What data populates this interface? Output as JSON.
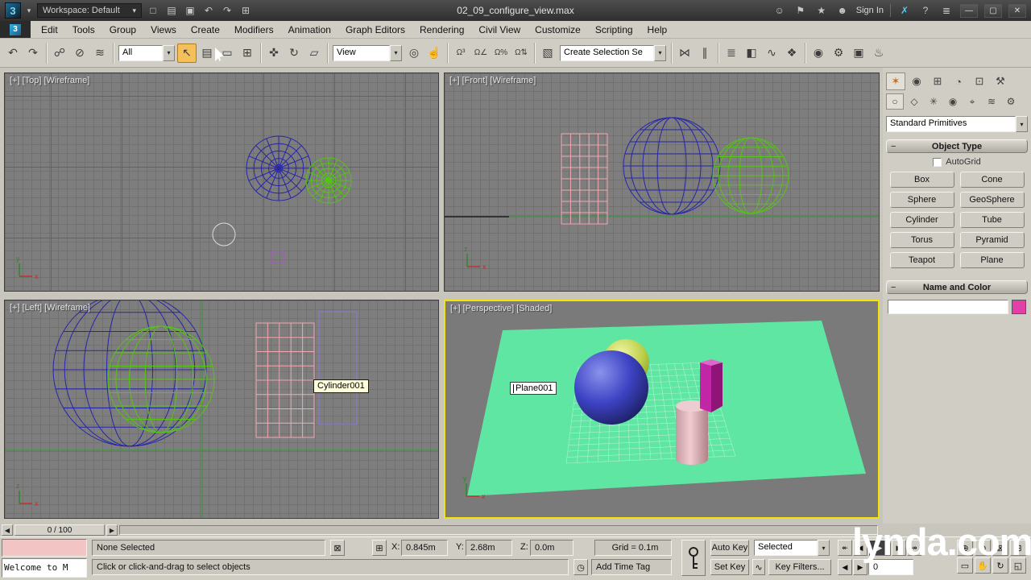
{
  "titlebar": {
    "workspace": "Workspace: Default",
    "doc_title": "02_09_configure_view.max",
    "sign_in": "Sign In"
  },
  "menubar": {
    "items": [
      "Edit",
      "Tools",
      "Group",
      "Views",
      "Create",
      "Modifiers",
      "Animation",
      "Graph Editors",
      "Rendering",
      "Civil View",
      "Customize",
      "Scripting",
      "Help"
    ]
  },
  "toolbar": {
    "selection_filter": "All",
    "coord_system": "View",
    "named_selection": "Create Selection Se"
  },
  "viewports": {
    "top_label": "[+] [Top] [Wireframe]",
    "front_label": "[+] [Front] [Wireframe]",
    "left_label": "[+] [Left] [Wireframe]",
    "persp_label": "[+] [Perspective] [Shaded]",
    "cylinder_tooltip": "Cylinder001",
    "plane_name": "Plane001"
  },
  "command_panel": {
    "category": "Standard Primitives",
    "object_type_title": "Object Type",
    "autogrid": "AutoGrid",
    "buttons": [
      "Box",
      "Cone",
      "Sphere",
      "GeoSphere",
      "Cylinder",
      "Tube",
      "Torus",
      "Pyramid",
      "Teapot",
      "Plane"
    ],
    "name_color_title": "Name and Color",
    "object_name": ""
  },
  "trackbar": {
    "position": "0 / 100"
  },
  "statusbar": {
    "listener_text": "Welcome to M",
    "selection": "None Selected",
    "x_label": "X:",
    "x_value": "0.845m",
    "y_label": "Y:",
    "y_value": "2.68m",
    "z_label": "Z:",
    "z_value": "0.0m",
    "grid": "Grid = 0.1m",
    "prompt": "Click or click-and-drag to select objects",
    "add_time_tag": "Add Time Tag",
    "auto_key": "Auto Key",
    "set_key": "Set Key",
    "key_mode": "Selected",
    "key_filters": "Key Filters...",
    "frame": "0"
  },
  "watermark": "lynda.com",
  "colors": {
    "swatch": "#e23fa9",
    "plane_green": "#5fe6a2"
  },
  "icons": {
    "logo": "3",
    "dropdown_arrow": "▾",
    "collapse": "−",
    "new_file": "□",
    "open_file": "▤",
    "save_file": "▣",
    "undo": "↶",
    "redo": "↷",
    "project": "⊞",
    "people": "☺",
    "flag": "⚑",
    "star": "★",
    "person": "☻",
    "x_mark": "✗",
    "help": "?",
    "menu": "≣",
    "minimize": "—",
    "restore": "▢",
    "close": "✕",
    "link": "☍",
    "unlink": "⊘",
    "bind": "≋",
    "select": "↖",
    "select_by_name": "▤",
    "region": "▭",
    "window_crossing": "⊞",
    "move": "✜",
    "rotate": "↻",
    "scale": "▱",
    "center": "◎",
    "manipulate": "☝",
    "snap3": "Ω³",
    "snap_angle": "Ω∠",
    "snap_percent": "Ω%",
    "snap_spinner": "Ω⇅",
    "named_sets": "▧",
    "mirror": "⋈",
    "align": "∥",
    "layers": "≣",
    "ribbon": "◧",
    "curve_editor": "∿",
    "schematic": "❖",
    "material_editor": "◉",
    "render_setup": "⚙",
    "frame_window": "▣",
    "render": "♨",
    "tab_create": "✶",
    "tab_modify": "◉",
    "tab_hierarchy": "⊞",
    "tab_motion": "◔",
    "tab_display": "⊡",
    "tab_utilities": "⚒",
    "cat_geometry": "○",
    "cat_shapes": "◇",
    "cat_lights": "✳",
    "cat_cameras": "◉",
    "cat_helpers": "⌖",
    "cat_spacewarps": "≋",
    "cat_systems": "⚙",
    "lock": "⊠",
    "abs_mode": "⊞",
    "time_tag": "◷",
    "check_wave": "∿",
    "track_left": "◀",
    "track_right": "▶",
    "go_start": "↞",
    "prev_frame": "◀",
    "play": "▶",
    "next_frame": "▶",
    "go_end": "↠",
    "zoom": "⊕",
    "zoom_all": "⊛",
    "zoom_extents": "⊠",
    "zoom_extents_all": "⊞",
    "zoom_region": "▭",
    "pan": "✋",
    "orbit": "↻",
    "maximize": "◱"
  }
}
